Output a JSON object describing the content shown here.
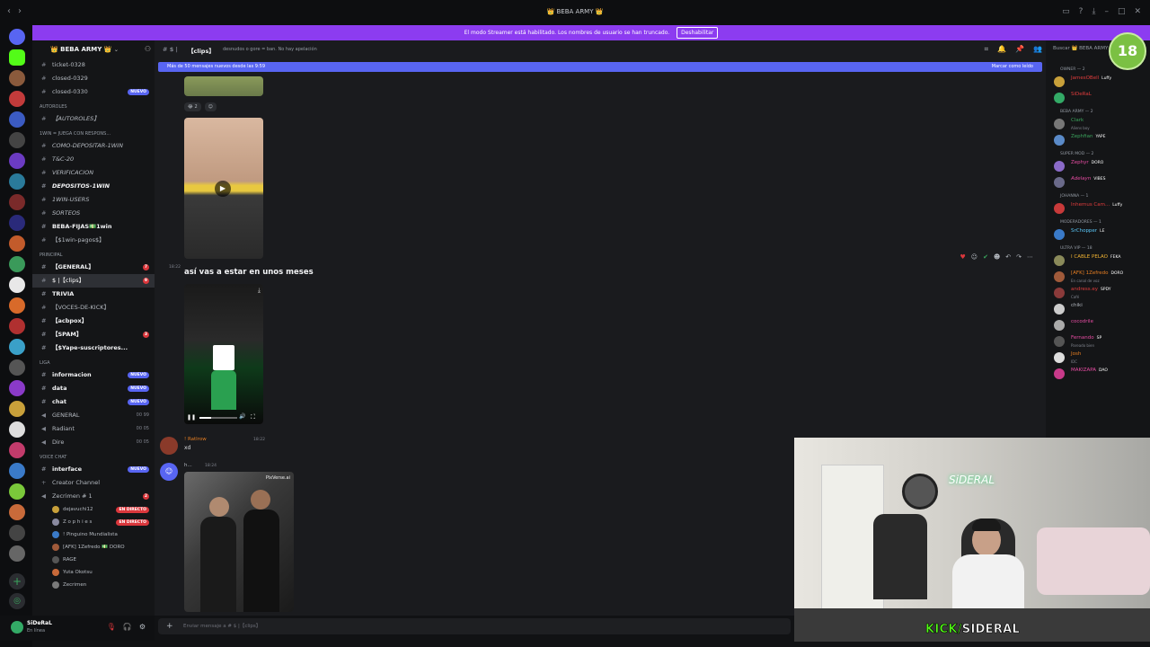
{
  "window": {
    "title": "👑 BEBA ARMY 👑",
    "nav_back": "‹",
    "nav_forward": "›"
  },
  "streamer_bar": {
    "text": "El modo Streamer está habilitado. Los nombres de usuario se han truncado.",
    "button": "Deshabilitar"
  },
  "guild": {
    "name": "👑 BEBA ARMY 👑"
  },
  "channels": {
    "top": [
      {
        "name": "ticket-0328"
      },
      {
        "name": "closed-0329"
      },
      {
        "name": "closed-0330",
        "badge": "NUEVO"
      }
    ],
    "cat_autoroles": "AUTOROLES",
    "autoroles": "【AUTOROLES】",
    "cat_1win": "1WIN = JUEGA CON RESPONS...",
    "win_channels": [
      {
        "name": "COMO-DEPOSITAR-1WIN"
      },
      {
        "name": "T&C-20"
      },
      {
        "name": "VERIFICACION"
      },
      {
        "name": "DEPOSITOS-1WIN",
        "bold": true
      },
      {
        "name": "1WIN-USERS"
      },
      {
        "name": "SORTEOS"
      },
      {
        "name": "BEBA-FIJAS💵1win",
        "bold": true
      },
      {
        "name": "【$1win-pagos$】"
      }
    ],
    "cat_principal": "PRINCIPAL",
    "principal": [
      {
        "name": "【GENERAL】",
        "bold": true,
        "badge_num": "7"
      },
      {
        "name": "$ |【clips】",
        "active": true,
        "badge_num": "9"
      },
      {
        "name": "TRIVIA",
        "bold": true
      },
      {
        "name": "【VOCES-DE-KICK】"
      },
      {
        "name": "【acbpox】",
        "bold": true
      },
      {
        "name": "【SPAM】",
        "bold": true,
        "badge_num": "3"
      },
      {
        "name": "【$Yape-suscriptores...",
        "bold": true
      }
    ],
    "cat_liga": "LIGA",
    "liga": [
      {
        "name": "informacion",
        "badge": "NUEVO"
      },
      {
        "name": "data",
        "badge": "NUEVO"
      },
      {
        "name": "chat",
        "badge": "NUEVO"
      },
      {
        "name": "GENERAL",
        "count": "00 99"
      },
      {
        "name": "Radiant",
        "count": "00 05"
      },
      {
        "name": "Dire",
        "count": "00 05"
      }
    ],
    "cat_voice": "VOICE CHAT",
    "voice": [
      {
        "name": "interface",
        "badge": "NUEVO"
      },
      {
        "name": "Creator Channel"
      },
      {
        "name": "Zecrimen # 1",
        "badge_num": "2"
      }
    ],
    "voice_users": [
      {
        "name": "dejavuchi12",
        "live": "EN DIRECTO"
      },
      {
        "name": "Z o p h i e s",
        "live": "EN DIRECTO"
      },
      {
        "name": "! Pinguino Mundialista"
      },
      {
        "name": "[AFK] 1Zefredo 💵 DORO"
      },
      {
        "name": "RAGE"
      },
      {
        "name": "Yuta Okotsu"
      },
      {
        "name": "Zecrimen"
      }
    ]
  },
  "user_panel": {
    "name": "SiDeRaL",
    "status": "En línea"
  },
  "chat": {
    "channel_name": "【clips】",
    "topic": "desnudos o gore = ban. No hay apelación",
    "new_messages": "Más de 50 mensajes nuevos desde las 9:59",
    "mark_read": "Marcar como leído",
    "reaction_count": "2",
    "msg1_time": "18:22",
    "msg1_text": "así vas a estar en unos meses",
    "msg2_author": "! Ratlrow",
    "msg2_time": "18:22",
    "msg2_text": "xd",
    "msg3_author": "h...",
    "msg3_time": "18:24",
    "video_watermark": "PixVerse.ai",
    "composer_placeholder": "Enviar mensaje a # $ |【clips】"
  },
  "members": {
    "search": "Buscar 👑 BEBA ARMY",
    "groups": [
      {
        "label": "OWNER — 2",
        "items": [
          {
            "name": "JamesOBell",
            "tag": "Luffy",
            "color": "#e03c3c"
          },
          {
            "name": "SiDeRaL",
            "color": "#e03c3c"
          }
        ]
      },
      {
        "label": "BEBA ARMY — 2",
        "items": [
          {
            "name": "Clark",
            "sub": "Aliens boy",
            "color": "#3ba55d"
          },
          {
            "name": "Zephfian",
            "tag": "YAPE",
            "color": "#3ba55d"
          }
        ]
      },
      {
        "label": "SUPER MOD — 2",
        "items": [
          {
            "name": "Zephyr",
            "tag": "DORO",
            "color": "#e84ca3"
          },
          {
            "name": "Adelayn",
            "tag": "VIBES",
            "color": "#e84ca3"
          }
        ]
      },
      {
        "label": "Johanna — 1",
        "items": [
          {
            "name": "Inhemus Cam...",
            "tag": "Luffy",
            "color": "#e03c3c"
          }
        ]
      },
      {
        "label": "MODERADORES — 1",
        "items": [
          {
            "name": "SrChopper",
            "tag": "LE",
            "color": "#5ac8fa"
          }
        ]
      },
      {
        "label": "ULTRA VIP — 18",
        "items": [
          {
            "name": "I CABLE PELAO",
            "tag": "FEKA",
            "color": "#f0b232"
          },
          {
            "name": "[AFK] 1Zefredo",
            "tag": "DORO",
            "sub": "En canal de voz",
            "color": "#e67e22"
          },
          {
            "name": "andress.ey",
            "tag": "SPDY",
            "sub": "Café",
            "color": "#e03c3c"
          },
          {
            "name": "chiki",
            "color": "#b5bac1"
          },
          {
            "name": "cocodrile",
            "color": "#e84ca3"
          },
          {
            "name": "Fernando",
            "tag": "SP",
            "sub": "Pareado bien",
            "color": "#e84ca3"
          },
          {
            "name": "Josh",
            "sub": "IDC",
            "color": "#e67e22"
          },
          {
            "name": "MAKIZAPA",
            "tag": "DAO",
            "color": "#e84ca3"
          }
        ]
      }
    ]
  },
  "age_badge": "18",
  "webcam": {
    "brand": "KICK/",
    "name": "SIDERAL",
    "neon_sign": "SiDERAL"
  }
}
